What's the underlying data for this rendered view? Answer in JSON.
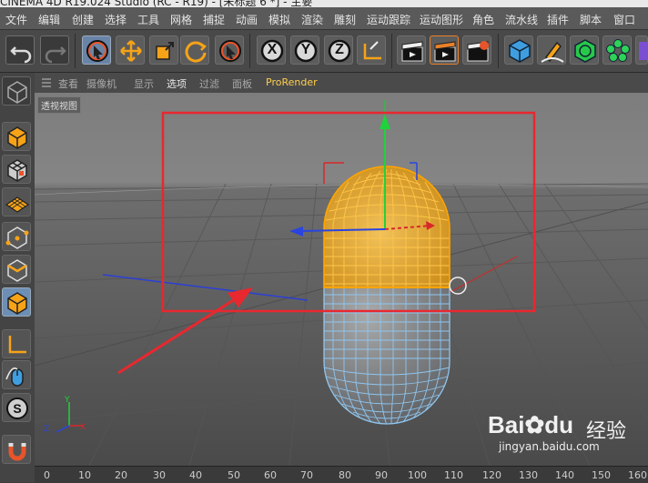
{
  "window": {
    "title": "CINEMA 4D R19.024 Studio (RC - R19) - [未标题 6 *] - 主要"
  },
  "menu": [
    "文件",
    "编辑",
    "创建",
    "选择",
    "工具",
    "网格",
    "捕捉",
    "动画",
    "模拟",
    "渲染",
    "雕刻",
    "运动跟踪",
    "运动图形",
    "角色",
    "流水线",
    "插件",
    "脚本",
    "窗口"
  ],
  "toolbar": {
    "axis_x": "X",
    "axis_y": "Y",
    "axis_z": "Z"
  },
  "viewport_menu": {
    "items": [
      "查看",
      "摄像机",
      "显示",
      "选项",
      "过滤",
      "面板"
    ],
    "render": "ProRender"
  },
  "viewport": {
    "label": "透视视图"
  },
  "timeline": {
    "ticks": [
      "0",
      "10",
      "20",
      "30",
      "40",
      "50",
      "60",
      "70",
      "80",
      "90",
      "100",
      "110",
      "120",
      "130",
      "140",
      "150",
      "160"
    ]
  },
  "watermark": {
    "logo": "Bai",
    "logo2": "du",
    "cn": "经验",
    "url": "jingyan.baidu.com"
  },
  "colors": {
    "accent_selection": "#ffa500",
    "annotation": "#e8282f",
    "axis_x": "#d8282a",
    "axis_y": "#1fd33a",
    "axis_z": "#2a44e0",
    "mesh_lower": "#8fc6f0"
  }
}
